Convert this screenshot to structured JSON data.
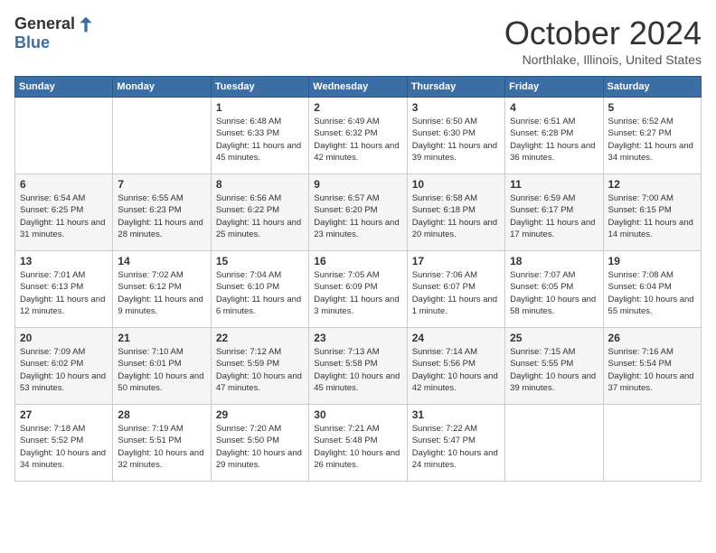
{
  "header": {
    "logo_general": "General",
    "logo_blue": "Blue",
    "month_title": "October 2024",
    "location": "Northlake, Illinois, United States"
  },
  "days_of_week": [
    "Sunday",
    "Monday",
    "Tuesday",
    "Wednesday",
    "Thursday",
    "Friday",
    "Saturday"
  ],
  "weeks": [
    [
      {
        "day": "",
        "info": ""
      },
      {
        "day": "",
        "info": ""
      },
      {
        "day": "1",
        "info": "Sunrise: 6:48 AM\nSunset: 6:33 PM\nDaylight: 11 hours and 45 minutes."
      },
      {
        "day": "2",
        "info": "Sunrise: 6:49 AM\nSunset: 6:32 PM\nDaylight: 11 hours and 42 minutes."
      },
      {
        "day": "3",
        "info": "Sunrise: 6:50 AM\nSunset: 6:30 PM\nDaylight: 11 hours and 39 minutes."
      },
      {
        "day": "4",
        "info": "Sunrise: 6:51 AM\nSunset: 6:28 PM\nDaylight: 11 hours and 36 minutes."
      },
      {
        "day": "5",
        "info": "Sunrise: 6:52 AM\nSunset: 6:27 PM\nDaylight: 11 hours and 34 minutes."
      }
    ],
    [
      {
        "day": "6",
        "info": "Sunrise: 6:54 AM\nSunset: 6:25 PM\nDaylight: 11 hours and 31 minutes."
      },
      {
        "day": "7",
        "info": "Sunrise: 6:55 AM\nSunset: 6:23 PM\nDaylight: 11 hours and 28 minutes."
      },
      {
        "day": "8",
        "info": "Sunrise: 6:56 AM\nSunset: 6:22 PM\nDaylight: 11 hours and 25 minutes."
      },
      {
        "day": "9",
        "info": "Sunrise: 6:57 AM\nSunset: 6:20 PM\nDaylight: 11 hours and 23 minutes."
      },
      {
        "day": "10",
        "info": "Sunrise: 6:58 AM\nSunset: 6:18 PM\nDaylight: 11 hours and 20 minutes."
      },
      {
        "day": "11",
        "info": "Sunrise: 6:59 AM\nSunset: 6:17 PM\nDaylight: 11 hours and 17 minutes."
      },
      {
        "day": "12",
        "info": "Sunrise: 7:00 AM\nSunset: 6:15 PM\nDaylight: 11 hours and 14 minutes."
      }
    ],
    [
      {
        "day": "13",
        "info": "Sunrise: 7:01 AM\nSunset: 6:13 PM\nDaylight: 11 hours and 12 minutes."
      },
      {
        "day": "14",
        "info": "Sunrise: 7:02 AM\nSunset: 6:12 PM\nDaylight: 11 hours and 9 minutes."
      },
      {
        "day": "15",
        "info": "Sunrise: 7:04 AM\nSunset: 6:10 PM\nDaylight: 11 hours and 6 minutes."
      },
      {
        "day": "16",
        "info": "Sunrise: 7:05 AM\nSunset: 6:09 PM\nDaylight: 11 hours and 3 minutes."
      },
      {
        "day": "17",
        "info": "Sunrise: 7:06 AM\nSunset: 6:07 PM\nDaylight: 11 hours and 1 minute."
      },
      {
        "day": "18",
        "info": "Sunrise: 7:07 AM\nSunset: 6:05 PM\nDaylight: 10 hours and 58 minutes."
      },
      {
        "day": "19",
        "info": "Sunrise: 7:08 AM\nSunset: 6:04 PM\nDaylight: 10 hours and 55 minutes."
      }
    ],
    [
      {
        "day": "20",
        "info": "Sunrise: 7:09 AM\nSunset: 6:02 PM\nDaylight: 10 hours and 53 minutes."
      },
      {
        "day": "21",
        "info": "Sunrise: 7:10 AM\nSunset: 6:01 PM\nDaylight: 10 hours and 50 minutes."
      },
      {
        "day": "22",
        "info": "Sunrise: 7:12 AM\nSunset: 5:59 PM\nDaylight: 10 hours and 47 minutes."
      },
      {
        "day": "23",
        "info": "Sunrise: 7:13 AM\nSunset: 5:58 PM\nDaylight: 10 hours and 45 minutes."
      },
      {
        "day": "24",
        "info": "Sunrise: 7:14 AM\nSunset: 5:56 PM\nDaylight: 10 hours and 42 minutes."
      },
      {
        "day": "25",
        "info": "Sunrise: 7:15 AM\nSunset: 5:55 PM\nDaylight: 10 hours and 39 minutes."
      },
      {
        "day": "26",
        "info": "Sunrise: 7:16 AM\nSunset: 5:54 PM\nDaylight: 10 hours and 37 minutes."
      }
    ],
    [
      {
        "day": "27",
        "info": "Sunrise: 7:18 AM\nSunset: 5:52 PM\nDaylight: 10 hours and 34 minutes."
      },
      {
        "day": "28",
        "info": "Sunrise: 7:19 AM\nSunset: 5:51 PM\nDaylight: 10 hours and 32 minutes."
      },
      {
        "day": "29",
        "info": "Sunrise: 7:20 AM\nSunset: 5:50 PM\nDaylight: 10 hours and 29 minutes."
      },
      {
        "day": "30",
        "info": "Sunrise: 7:21 AM\nSunset: 5:48 PM\nDaylight: 10 hours and 26 minutes."
      },
      {
        "day": "31",
        "info": "Sunrise: 7:22 AM\nSunset: 5:47 PM\nDaylight: 10 hours and 24 minutes."
      },
      {
        "day": "",
        "info": ""
      },
      {
        "day": "",
        "info": ""
      }
    ]
  ]
}
